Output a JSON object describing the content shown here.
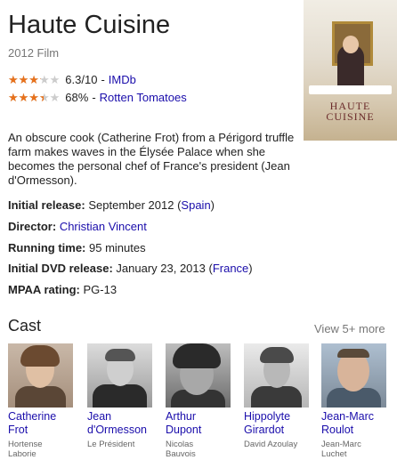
{
  "movie": {
    "title": "Haute Cuisine",
    "subtitle": "2012 Film",
    "ratings": [
      {
        "score": "6.3/10",
        "source": "IMDb",
        "stars_fraction": 0.63
      },
      {
        "score": "68%",
        "source": "Rotten Tomatoes",
        "stars_fraction": 0.68
      }
    ],
    "star_glyphs": "★★★★★",
    "separator": "-",
    "description": "An obscure cook (Catherine Frot) from a Périgord truffle farm makes waves in the Élysée Palace when she becomes the personal chef of France's president (Jean d'Ormesson).",
    "poster": {
      "top_text": "",
      "title_line1": "HAUTE",
      "title_line2": "CUISINE"
    }
  },
  "facts": {
    "initial_release": {
      "label": "Initial release:",
      "value": "September 2012 (",
      "link": "Spain",
      "suffix": ")"
    },
    "director": {
      "label": "Director:",
      "link": "Christian Vincent"
    },
    "running_time": {
      "label": "Running time:",
      "value": "95 minutes"
    },
    "dvd_release": {
      "label": "Initial DVD release:",
      "value": "January 23, 2013 (",
      "link": "France",
      "suffix": ")"
    },
    "mpaa": {
      "label": "MPAA rating:",
      "value": "PG-13"
    }
  },
  "cast": {
    "heading": "Cast",
    "view_more": "View 5+ more",
    "members": [
      {
        "name_line1": "Catherine",
        "name_line2": "Frot",
        "role_line1": "Hortense",
        "role_line2": "Laborie"
      },
      {
        "name_line1": "Jean",
        "name_line2": "d'Ormesson",
        "role_line1": "Le Président",
        "role_line2": ""
      },
      {
        "name_line1": "Arthur",
        "name_line2": "Dupont",
        "role_line1": "Nicolas",
        "role_line2": "Bauvois"
      },
      {
        "name_line1": "Hippolyte",
        "name_line2": "Girardot",
        "role_line1": "David Azoulay",
        "role_line2": ""
      },
      {
        "name_line1": "Jean-Marc",
        "name_line2": "Roulot",
        "role_line1": "Jean-Marc",
        "role_line2": "Luchet"
      }
    ]
  },
  "colors": {
    "link": "#1a0dab",
    "star": "#e7711b",
    "muted": "#777777"
  }
}
